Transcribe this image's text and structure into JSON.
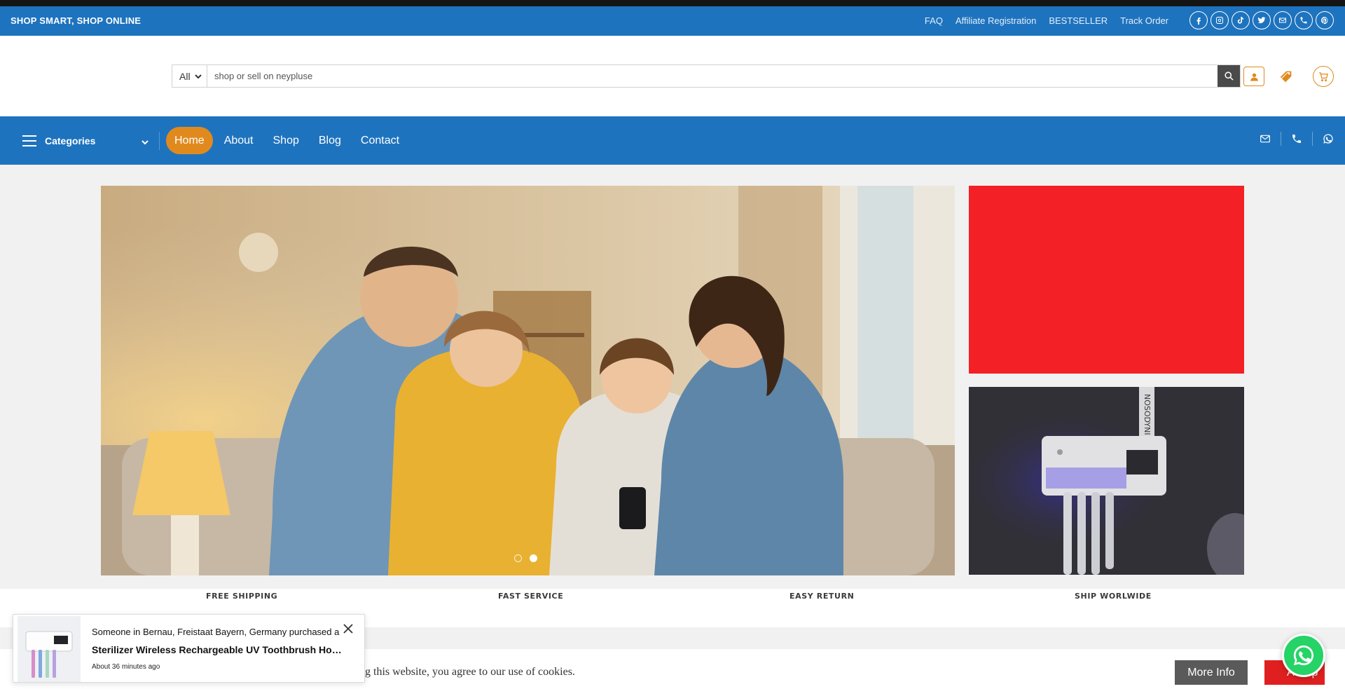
{
  "topbar": {
    "slogan": "SHOP SMART, SHOP ONLINE",
    "links": [
      "FAQ",
      "Affiliate Registration",
      "BESTSELLER",
      "Track Order"
    ],
    "socials": [
      "facebook-icon",
      "instagram-icon",
      "tiktok-icon",
      "twitter-icon",
      "email-icon",
      "phone-icon",
      "pinterest-icon"
    ]
  },
  "search": {
    "category": "All",
    "placeholder": "shop or sell on neypluse"
  },
  "nav": {
    "categories_label": "Categories",
    "items": [
      "Home",
      "About",
      "Shop",
      "Blog",
      "Contact"
    ],
    "active": "Home",
    "right_icons": [
      "email-icon",
      "phone-icon",
      "whatsapp-icon"
    ]
  },
  "slider": {
    "dots": 2,
    "active_dot": 2
  },
  "banner_text": "NOSODYNI",
  "features": [
    "FREE SHIPPING",
    "FAST SERVICE",
    "EASY RETURN",
    "SHIP WORLWIDE"
  ],
  "cookie": {
    "text": "ng this website, you agree to our use of cookies.",
    "more_label": "More Info",
    "accept_label": "Accep"
  },
  "popup": {
    "line1": "Someone in Bernau, Freistaat Bayern, Germany purchased a",
    "product": "Sterilizer Wireless Rechargeable UV Toothbrush Holder",
    "time": "About 36 minutes ago"
  },
  "colors": {
    "primary_blue": "#1e73be",
    "accent_orange": "#e08a1e",
    "banner_red": "#f32025",
    "accept_red": "#e02020",
    "whatsapp_green": "#25d366"
  }
}
